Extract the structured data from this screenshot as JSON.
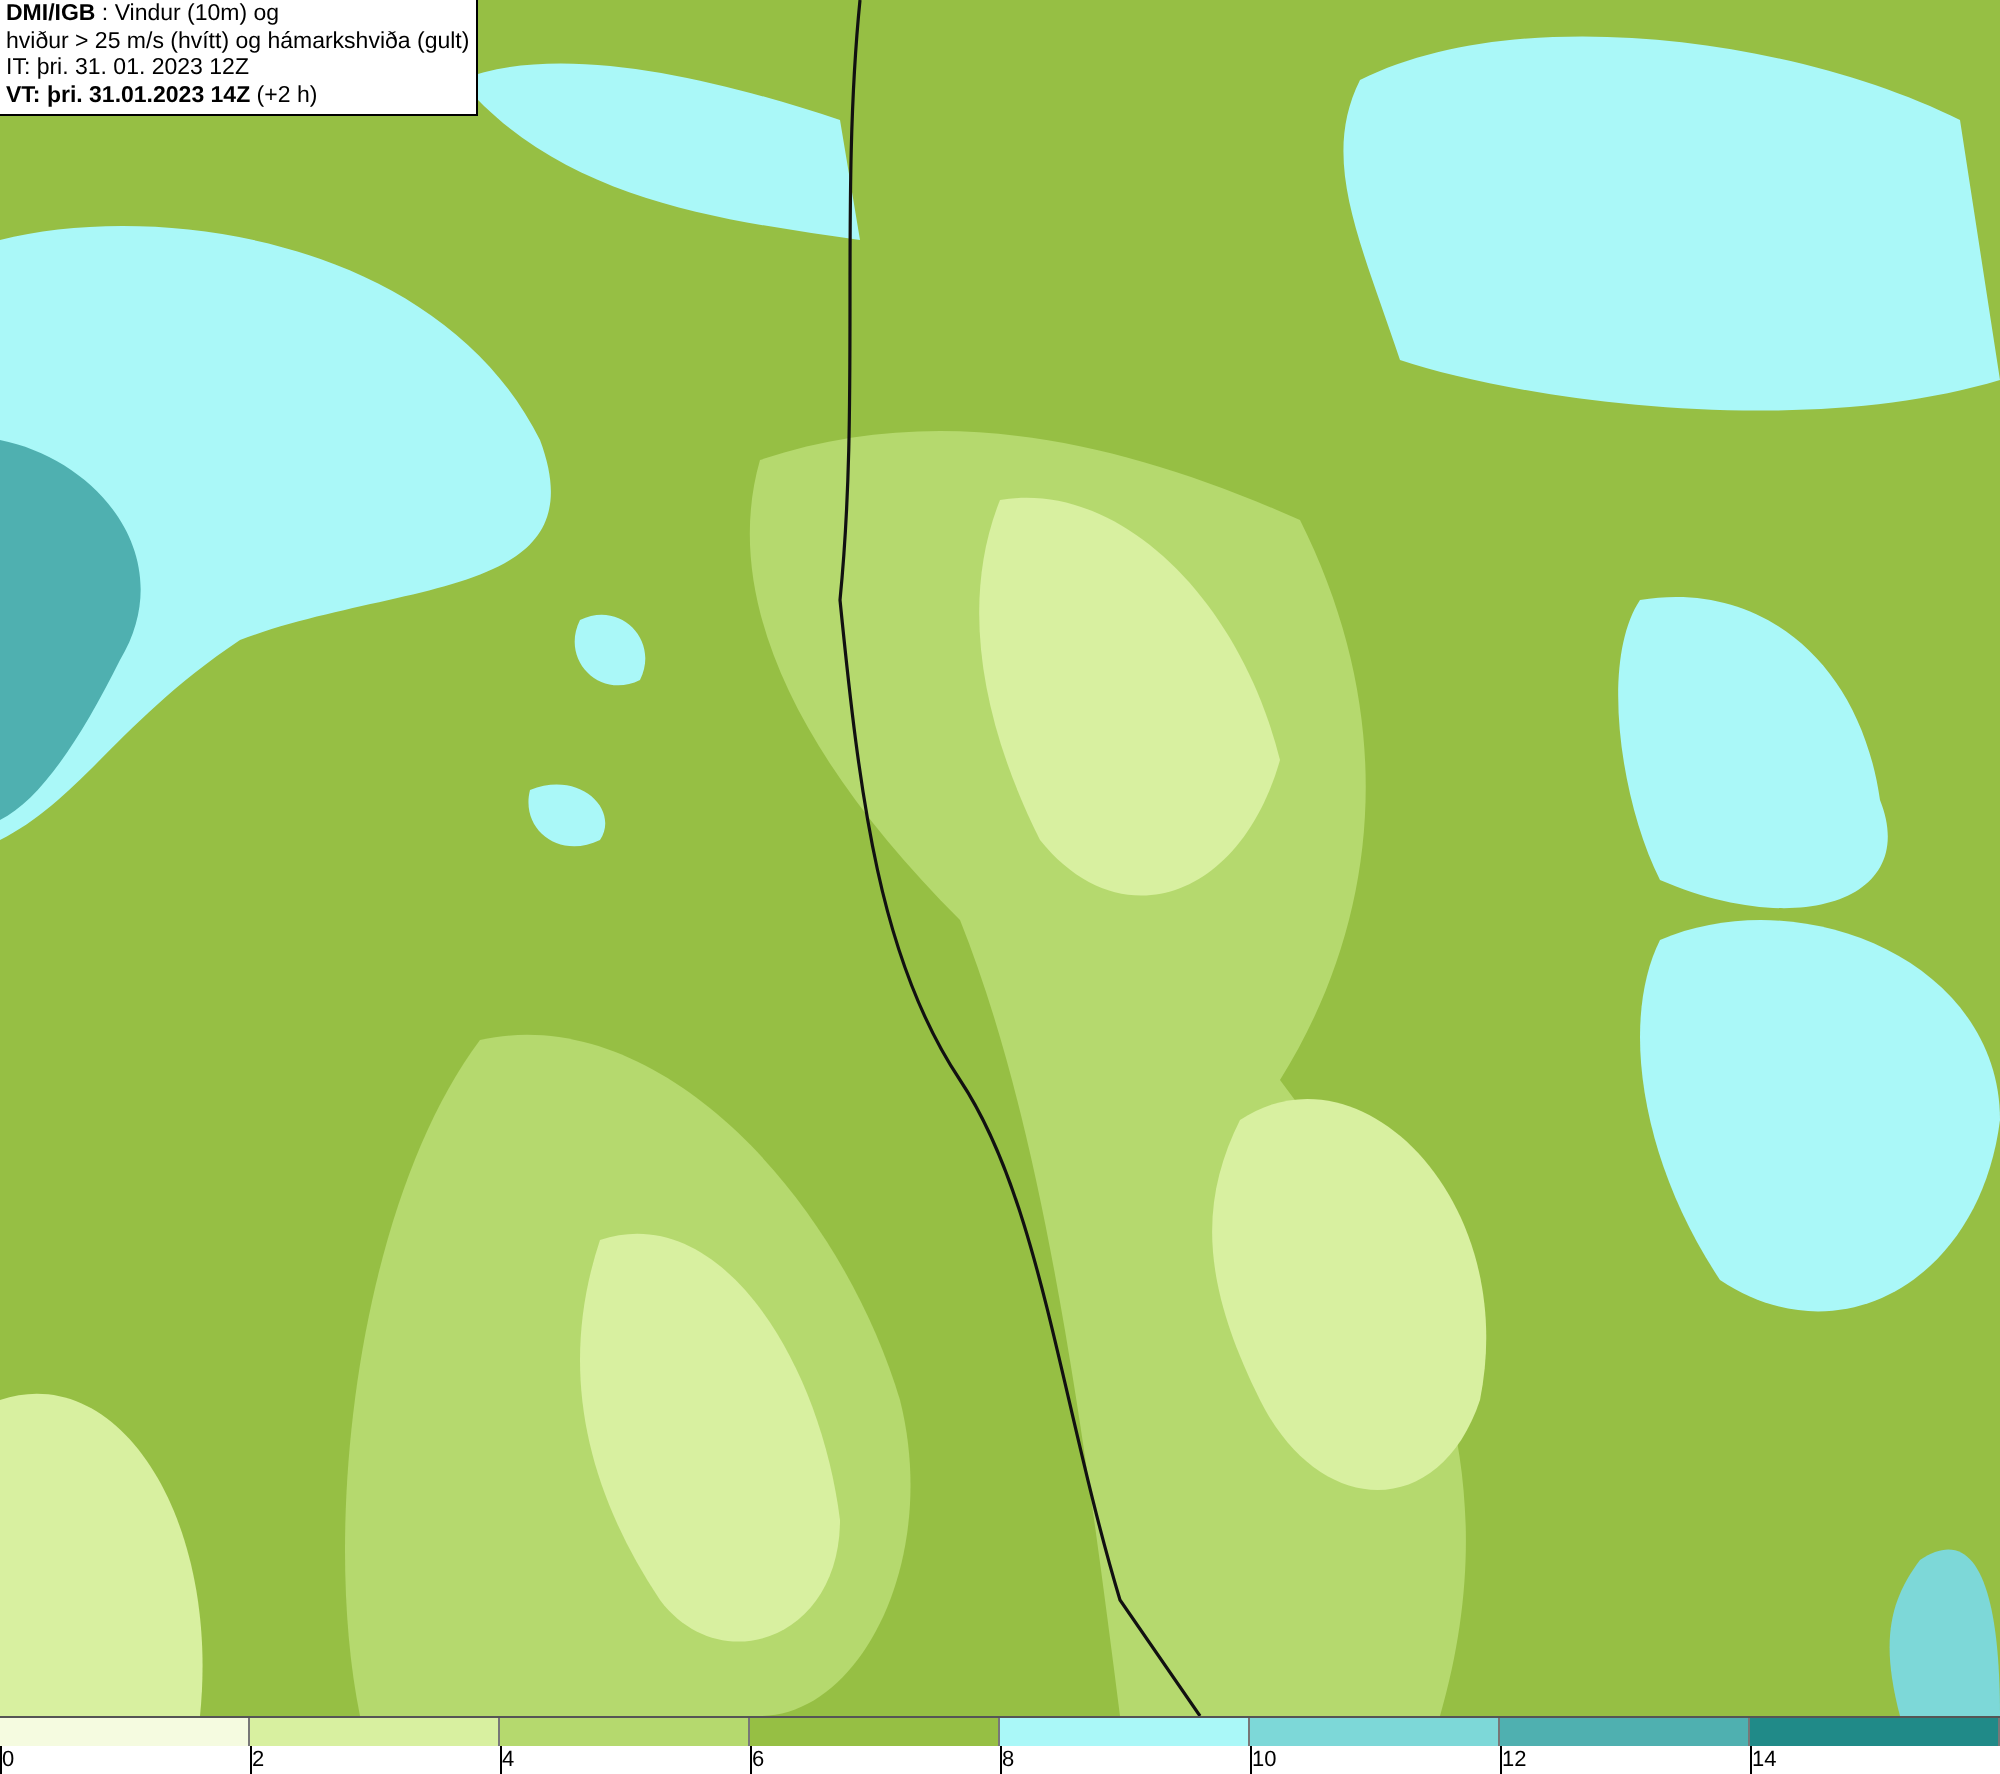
{
  "header": {
    "lines": [
      "**DMI/IGB** : Vindur (10m) og",
      "hviður > 25 m/s (hvítt) og hámarkshviða (gult)",
      "IT: þri. 31. 01. 2023 12Z",
      "**VT: þri. 31.01.2023 14Z** (+2 h)"
    ]
  },
  "legend": {
    "bins": [
      {
        "color": "#f5fbe0"
      },
      {
        "color": "#d8f0a0"
      },
      {
        "color": "#b5d96e"
      },
      {
        "color": "#96bf44"
      },
      {
        "color": "#aaf8f8"
      },
      {
        "color": "#7dd8d8"
      },
      {
        "color": "#4fb0b0"
      },
      {
        "color": "#208a88"
      }
    ],
    "ticks": [
      "0",
      "2",
      "4",
      "6",
      "8",
      "10",
      "12",
      "14"
    ]
  }
}
